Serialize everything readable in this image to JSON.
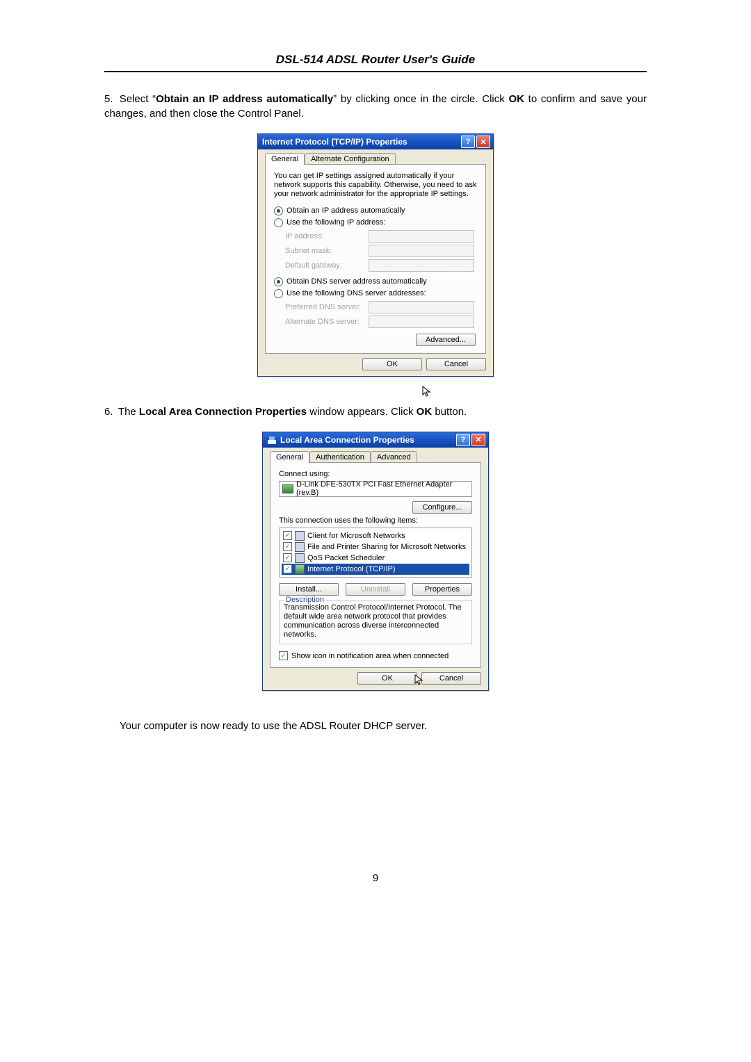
{
  "header": {
    "title": "DSL-514 ADSL Router User's Guide"
  },
  "steps": {
    "s5_num": "5.",
    "s5_a": "Select “",
    "s5_bold": "Obtain an IP address automatically",
    "s5_b": "” by clicking once in the circle. Click ",
    "s5_ok": "OK",
    "s5_c": " to confirm and save your changes, and then close the Control Panel.",
    "s6_num": "6.",
    "s6_a": "The ",
    "s6_bold": "Local Area Connection Properties",
    "s6_b": " window appears. Click ",
    "s6_ok": "OK",
    "s6_c": " button.",
    "outro": "Your computer is now ready to use the ADSL Router DHCP server."
  },
  "tcpip": {
    "title": "Internet Protocol (TCP/IP) Properties",
    "tabs": {
      "general": "General",
      "alt": "Alternate Configuration"
    },
    "desc": "You can get IP settings assigned automatically if your network supports this capability. Otherwise, you need to ask your network administrator for the appropriate IP settings.",
    "r1": "Obtain an IP address automatically",
    "r2": "Use the following IP address:",
    "ip_label": "IP address:",
    "subnet_label": "Subnet mask:",
    "gw_label": "Default gateway:",
    "r3": "Obtain DNS server address automatically",
    "r4": "Use the following DNS server addresses:",
    "pdns_label": "Preferred DNS server:",
    "adns_label": "Alternate DNS server:",
    "advanced": "Advanced...",
    "ok": "OK",
    "cancel": "Cancel"
  },
  "lan": {
    "title": "Local Area Connection Properties",
    "tabs": {
      "general": "General",
      "auth": "Authentication",
      "adv": "Advanced"
    },
    "connect_using": "Connect using:",
    "adapter": "D-Link DFE-530TX PCI Fast Ethernet Adapter (rev.B)",
    "configure": "Configure...",
    "uses_label": "This connection uses the following items:",
    "items": [
      "Client for Microsoft Networks",
      "File and Printer Sharing for Microsoft Networks",
      "QoS Packet Scheduler",
      "Internet Protocol (TCP/IP)"
    ],
    "install": "Install...",
    "uninstall": "Uninstall",
    "properties": "Properties",
    "desc_legend": "Description",
    "desc_text": "Transmission Control Protocol/Internet Protocol. The default wide area network protocol that provides communication across diverse interconnected networks.",
    "show_icon": "Show icon in notification area when connected",
    "ok": "OK",
    "cancel": "Cancel"
  },
  "page_number": "9"
}
